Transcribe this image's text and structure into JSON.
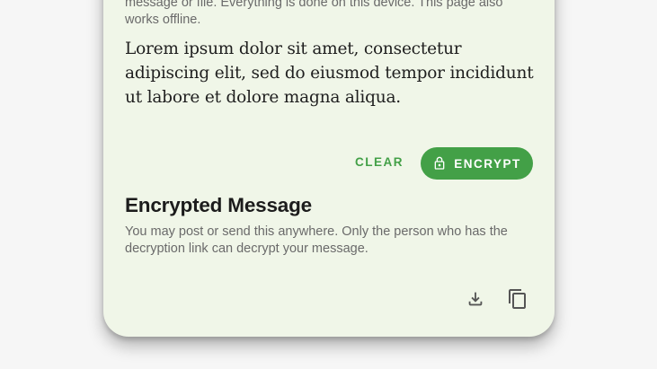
{
  "intro_text": "message or file. Everything is done on this device. This page also works offline.",
  "message_text": "Lorem ipsum dolor sit amet, consectetur adipiscing elit, sed do eiusmod tempor incididunt ut labore et dolore magna aliqua.",
  "actions": {
    "clear_label": "CLEAR",
    "encrypt_label": "ENCRYPT",
    "encrypt_icon": "lock-icon"
  },
  "encrypted": {
    "title": "Encrypted Message",
    "description": "You may post or send this anywhere. Only the person who has the decryption link can decrypt your message.",
    "download_icon": "download-icon",
    "copy_icon": "copy-icon"
  },
  "colors": {
    "accent": "#43a047",
    "card_background": "#f0f6e8",
    "page_background": "#f6f6f6"
  }
}
